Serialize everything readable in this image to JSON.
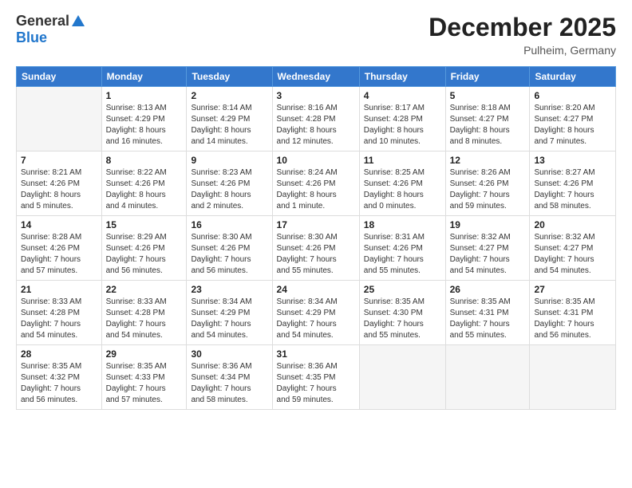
{
  "logo": {
    "general": "General",
    "blue": "Blue"
  },
  "title": {
    "month": "December 2025",
    "location": "Pulheim, Germany"
  },
  "days_header": [
    "Sunday",
    "Monday",
    "Tuesday",
    "Wednesday",
    "Thursday",
    "Friday",
    "Saturday"
  ],
  "weeks": [
    [
      {
        "day": "",
        "info": ""
      },
      {
        "day": "1",
        "info": "Sunrise: 8:13 AM\nSunset: 4:29 PM\nDaylight: 8 hours\nand 16 minutes."
      },
      {
        "day": "2",
        "info": "Sunrise: 8:14 AM\nSunset: 4:29 PM\nDaylight: 8 hours\nand 14 minutes."
      },
      {
        "day": "3",
        "info": "Sunrise: 8:16 AM\nSunset: 4:28 PM\nDaylight: 8 hours\nand 12 minutes."
      },
      {
        "day": "4",
        "info": "Sunrise: 8:17 AM\nSunset: 4:28 PM\nDaylight: 8 hours\nand 10 minutes."
      },
      {
        "day": "5",
        "info": "Sunrise: 8:18 AM\nSunset: 4:27 PM\nDaylight: 8 hours\nand 8 minutes."
      },
      {
        "day": "6",
        "info": "Sunrise: 8:20 AM\nSunset: 4:27 PM\nDaylight: 8 hours\nand 7 minutes."
      }
    ],
    [
      {
        "day": "7",
        "info": "Sunrise: 8:21 AM\nSunset: 4:26 PM\nDaylight: 8 hours\nand 5 minutes."
      },
      {
        "day": "8",
        "info": "Sunrise: 8:22 AM\nSunset: 4:26 PM\nDaylight: 8 hours\nand 4 minutes."
      },
      {
        "day": "9",
        "info": "Sunrise: 8:23 AM\nSunset: 4:26 PM\nDaylight: 8 hours\nand 2 minutes."
      },
      {
        "day": "10",
        "info": "Sunrise: 8:24 AM\nSunset: 4:26 PM\nDaylight: 8 hours\nand 1 minute."
      },
      {
        "day": "11",
        "info": "Sunrise: 8:25 AM\nSunset: 4:26 PM\nDaylight: 8 hours\nand 0 minutes."
      },
      {
        "day": "12",
        "info": "Sunrise: 8:26 AM\nSunset: 4:26 PM\nDaylight: 7 hours\nand 59 minutes."
      },
      {
        "day": "13",
        "info": "Sunrise: 8:27 AM\nSunset: 4:26 PM\nDaylight: 7 hours\nand 58 minutes."
      }
    ],
    [
      {
        "day": "14",
        "info": "Sunrise: 8:28 AM\nSunset: 4:26 PM\nDaylight: 7 hours\nand 57 minutes."
      },
      {
        "day": "15",
        "info": "Sunrise: 8:29 AM\nSunset: 4:26 PM\nDaylight: 7 hours\nand 56 minutes."
      },
      {
        "day": "16",
        "info": "Sunrise: 8:30 AM\nSunset: 4:26 PM\nDaylight: 7 hours\nand 56 minutes."
      },
      {
        "day": "17",
        "info": "Sunrise: 8:30 AM\nSunset: 4:26 PM\nDaylight: 7 hours\nand 55 minutes."
      },
      {
        "day": "18",
        "info": "Sunrise: 8:31 AM\nSunset: 4:26 PM\nDaylight: 7 hours\nand 55 minutes."
      },
      {
        "day": "19",
        "info": "Sunrise: 8:32 AM\nSunset: 4:27 PM\nDaylight: 7 hours\nand 54 minutes."
      },
      {
        "day": "20",
        "info": "Sunrise: 8:32 AM\nSunset: 4:27 PM\nDaylight: 7 hours\nand 54 minutes."
      }
    ],
    [
      {
        "day": "21",
        "info": "Sunrise: 8:33 AM\nSunset: 4:28 PM\nDaylight: 7 hours\nand 54 minutes."
      },
      {
        "day": "22",
        "info": "Sunrise: 8:33 AM\nSunset: 4:28 PM\nDaylight: 7 hours\nand 54 minutes."
      },
      {
        "day": "23",
        "info": "Sunrise: 8:34 AM\nSunset: 4:29 PM\nDaylight: 7 hours\nand 54 minutes."
      },
      {
        "day": "24",
        "info": "Sunrise: 8:34 AM\nSunset: 4:29 PM\nDaylight: 7 hours\nand 54 minutes."
      },
      {
        "day": "25",
        "info": "Sunrise: 8:35 AM\nSunset: 4:30 PM\nDaylight: 7 hours\nand 55 minutes."
      },
      {
        "day": "26",
        "info": "Sunrise: 8:35 AM\nSunset: 4:31 PM\nDaylight: 7 hours\nand 55 minutes."
      },
      {
        "day": "27",
        "info": "Sunrise: 8:35 AM\nSunset: 4:31 PM\nDaylight: 7 hours\nand 56 minutes."
      }
    ],
    [
      {
        "day": "28",
        "info": "Sunrise: 8:35 AM\nSunset: 4:32 PM\nDaylight: 7 hours\nand 56 minutes."
      },
      {
        "day": "29",
        "info": "Sunrise: 8:35 AM\nSunset: 4:33 PM\nDaylight: 7 hours\nand 57 minutes."
      },
      {
        "day": "30",
        "info": "Sunrise: 8:36 AM\nSunset: 4:34 PM\nDaylight: 7 hours\nand 58 minutes."
      },
      {
        "day": "31",
        "info": "Sunrise: 8:36 AM\nSunset: 4:35 PM\nDaylight: 7 hours\nand 59 minutes."
      },
      {
        "day": "",
        "info": ""
      },
      {
        "day": "",
        "info": ""
      },
      {
        "day": "",
        "info": ""
      }
    ]
  ]
}
